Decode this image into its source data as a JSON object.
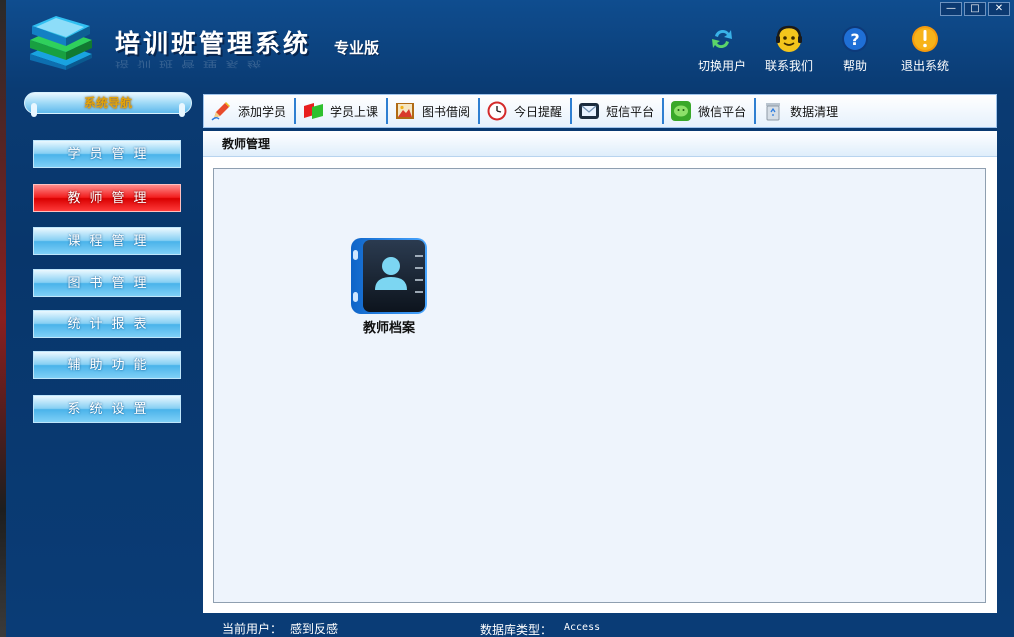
{
  "window": {
    "controls": {
      "minimize": "—",
      "maximize": "□",
      "close": "✕"
    }
  },
  "header": {
    "app_title": "培训班管理系统",
    "edition": "专业版",
    "actions": [
      {
        "label": "切换用户",
        "icon": "switch-user-icon"
      },
      {
        "label": "联系我们",
        "icon": "contact-us-icon"
      },
      {
        "label": "帮助",
        "icon": "help-icon"
      },
      {
        "label": "退出系统",
        "icon": "exit-icon"
      }
    ]
  },
  "sidebar": {
    "title": "系统导航",
    "items": [
      {
        "label": "学员管理",
        "active": false
      },
      {
        "label": "教师管理",
        "active": true
      },
      {
        "label": "课程管理",
        "active": false
      },
      {
        "label": "图书管理",
        "active": false
      },
      {
        "label": "统计报表",
        "active": false
      },
      {
        "label": "辅助功能",
        "active": false
      },
      {
        "label": "系统设置",
        "active": false
      }
    ]
  },
  "toolbar": {
    "items": [
      {
        "label": "添加学员",
        "icon": "pen-icon"
      },
      {
        "label": "学员上课",
        "icon": "flag-icon"
      },
      {
        "label": "图书借阅",
        "icon": "book-icon"
      },
      {
        "label": "今日提醒",
        "icon": "clock-icon"
      },
      {
        "label": "短信平台",
        "icon": "envelope-icon"
      },
      {
        "label": "微信平台",
        "icon": "wechat-icon"
      },
      {
        "label": "数据清理",
        "icon": "recycle-bin-icon"
      }
    ]
  },
  "panel": {
    "title": "教师管理",
    "modules": [
      {
        "label": "教师档案",
        "icon": "contact-book-icon"
      }
    ]
  },
  "status": {
    "user_label": "当前用户：",
    "user_value": "感到反感",
    "db_label": "数据库类型：",
    "db_value": "Access"
  },
  "colors": {
    "background": "#0a3c76",
    "nav_button": "#4ab3ea",
    "nav_active": "#d90000",
    "toolbar_divider": "#2f7fd1"
  }
}
